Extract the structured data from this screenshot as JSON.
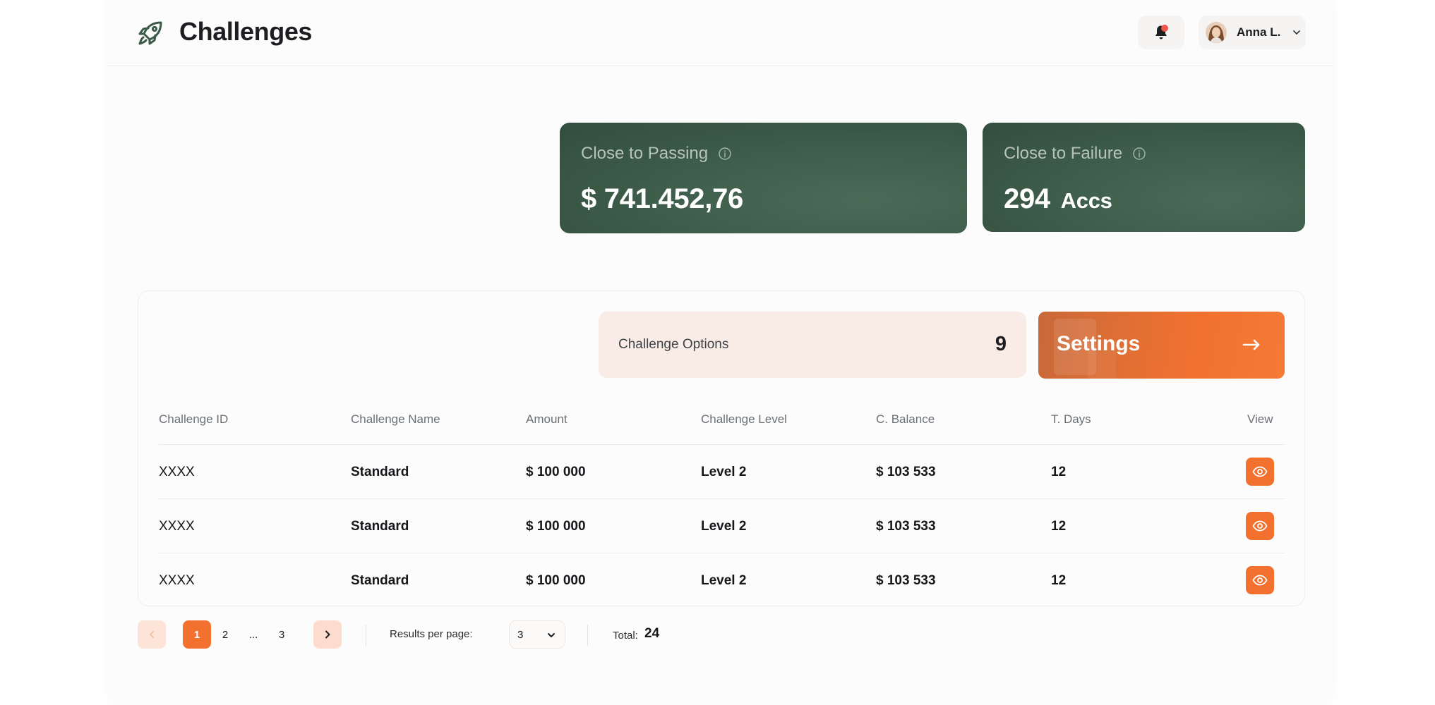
{
  "header": {
    "title": "Challenges",
    "logo_icon": "rocket-icon",
    "notification_icon": "bell-icon",
    "user": {
      "name": "Anna L.",
      "menu_icon": "chevron-down-icon"
    }
  },
  "stats": [
    {
      "label": "Close to Passing",
      "value": "$ 741.452,76",
      "unit": "",
      "icon": "info-icon"
    },
    {
      "label": "Close to Failure",
      "value": "294",
      "unit": "Accs",
      "icon": "info-icon"
    }
  ],
  "options": {
    "label": "Challenge Options",
    "count": "9"
  },
  "settings": {
    "label": "Settings",
    "icon": "arrow-right-icon"
  },
  "table": {
    "columns": [
      "Challenge ID",
      "Challenge Name",
      "Amount",
      "Challenge Level",
      "C. Balance",
      "T. Days",
      "View"
    ],
    "rows": [
      {
        "id": "XXXX",
        "name": "Standard",
        "amount": "$ 100 000",
        "level": "Level 2",
        "balance": "$ 103 533",
        "days": "12"
      },
      {
        "id": "XXXX",
        "name": "Standard",
        "amount": "$ 100 000",
        "level": "Level 2",
        "balance": "$ 103 533",
        "days": "12"
      },
      {
        "id": "XXXX",
        "name": "Standard",
        "amount": "$ 100 000",
        "level": "Level 2",
        "balance": "$ 103 533",
        "days": "12"
      }
    ],
    "view_icon": "eye-icon"
  },
  "pagination": {
    "pages": [
      "1",
      "2",
      "...",
      "3"
    ],
    "current": "1",
    "results_per_page_label": "Results per page:",
    "results_per_page": "3",
    "total_label": "Total:",
    "total": "24"
  },
  "colors": {
    "accent": "#f2712f",
    "card_green": "#3f5e4b",
    "options_bg": "#f9ece7"
  }
}
